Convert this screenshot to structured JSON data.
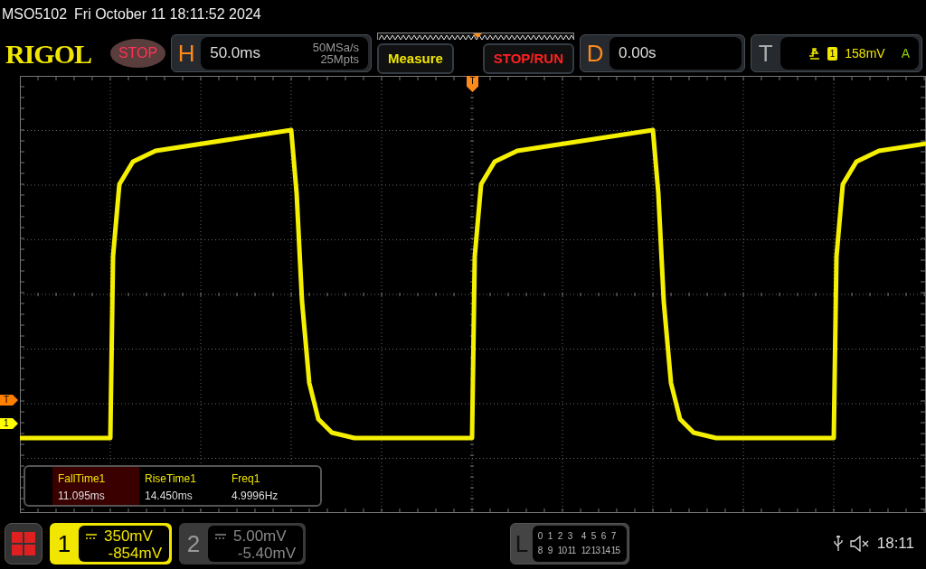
{
  "title_bar": {
    "model": "MSO5102",
    "datetime": "Fri October 11 18:11:52 2024"
  },
  "toolbar": {
    "logo": "RIGOL",
    "run_state": "STOP",
    "horizontal": {
      "label": "H",
      "timebase": "50.0ms",
      "sample_rate": "50MSa/s",
      "memory_depth": "25Mpts"
    },
    "buttons": [
      {
        "label": "Measure",
        "kind": "menu"
      },
      {
        "label": "STOP/RUN",
        "kind": "action"
      }
    ],
    "delay": {
      "label": "D",
      "value": "0.00s"
    },
    "trigger": {
      "label": "T",
      "channel": "1",
      "level": "158mV",
      "mode": "A"
    }
  },
  "screen": {
    "trigger_marker": "T",
    "markers": [
      {
        "label": "T",
        "color": "#ff7f00"
      },
      {
        "label": "1",
        "color": "#ffff00"
      }
    ]
  },
  "measurements": [
    {
      "name": "FallTime1",
      "value": "11.095ms",
      "selected": true
    },
    {
      "name": "RiseTime1",
      "value": "14.450ms",
      "selected": false
    },
    {
      "name": "Freq1",
      "value": "4.9996Hz",
      "selected": false
    }
  ],
  "channels": [
    {
      "number": "1",
      "scale": "350mV",
      "offset": "-854mV",
      "on": true
    },
    {
      "number": "2",
      "scale": "5.00mV",
      "offset": "-5.40mV",
      "on": false
    }
  ],
  "logic": {
    "label": "L",
    "rows": [
      [
        "0",
        "1",
        "2",
        "3",
        "4",
        "5",
        "6",
        "7"
      ],
      [
        "8",
        "9",
        "10",
        "11",
        "12",
        "13",
        "14",
        "15"
      ]
    ]
  },
  "status": {
    "time": "18:11"
  }
}
